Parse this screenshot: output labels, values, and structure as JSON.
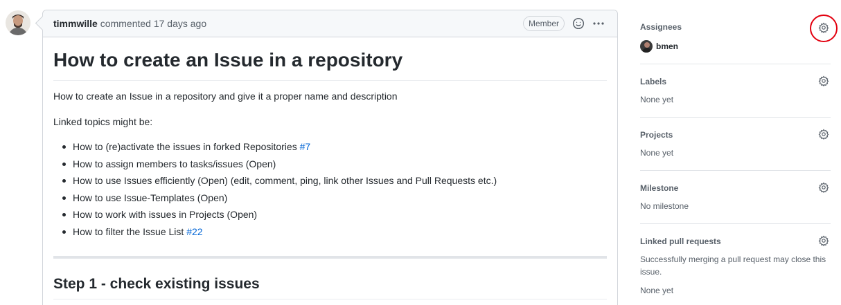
{
  "comment": {
    "author": "timmwille",
    "action": "commented 17 days ago",
    "badge": "Member",
    "emoji_icon": "smiley-icon",
    "more_icon": "kebab-horizontal-icon"
  },
  "content": {
    "title": "How to create an Issue in a repository",
    "intro": "How to create an Issue in a repository and give it a proper name and description",
    "linked_intro": "Linked topics might be:",
    "items": [
      {
        "text": "How to (re)activate the issues in forked Repositories ",
        "link": "#7"
      },
      {
        "text": "How to assign members to tasks/issues (Open)",
        "link": ""
      },
      {
        "text": "How to use Issues efficiently (Open) (edit, comment, ping, link other Issues and Pull Requests etc.)",
        "link": ""
      },
      {
        "text": "How to use Issue-Templates (Open)",
        "link": ""
      },
      {
        "text": "How to work with issues in Projects (Open)",
        "link": ""
      },
      {
        "text": "How to filter the Issue List ",
        "link": "#22"
      }
    ],
    "step1": "Step 1 - check existing issues"
  },
  "sidebar": {
    "assignees": {
      "title": "Assignees",
      "user": "bmen"
    },
    "labels": {
      "title": "Labels",
      "value": "None yet"
    },
    "projects": {
      "title": "Projects",
      "value": "None yet"
    },
    "milestone": {
      "title": "Milestone",
      "value": "No milestone"
    },
    "linked_prs": {
      "title": "Linked pull requests",
      "description": "Successfully merging a pull request may close this issue.",
      "value": "None yet"
    },
    "gear_icon": "gear-icon"
  },
  "colors": {
    "link": "#0366d6",
    "highlight": "#e3000f"
  }
}
